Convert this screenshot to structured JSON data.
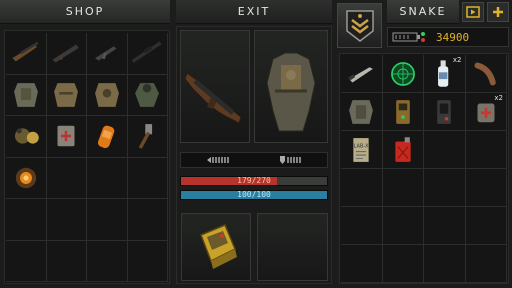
{
  "header": {
    "shop_label": "SHOP",
    "exit_label": "EXIT",
    "player_label": "SNAKE",
    "money": "34900",
    "rank_icon": "rank-chevron-icon",
    "add_icon": "plus-icon",
    "video_icon": "video-reward-icon"
  },
  "shop": {
    "items": [
      {
        "name": "rifle",
        "multiplier": ""
      },
      {
        "name": "assault-rifle",
        "multiplier": ""
      },
      {
        "name": "pistol",
        "multiplier": ""
      },
      {
        "name": "sniper-rifle",
        "multiplier": ""
      },
      {
        "name": "armor-vest",
        "multiplier": ""
      },
      {
        "name": "tactical-vest",
        "multiplier": ""
      },
      {
        "name": "exoskeleton",
        "multiplier": ""
      },
      {
        "name": "hazmat-suit",
        "multiplier": ""
      },
      {
        "name": "gas-mask",
        "multiplier": ""
      },
      {
        "name": "medkit-pouch",
        "multiplier": ""
      },
      {
        "name": "energy-drink",
        "multiplier": ""
      },
      {
        "name": "hammer",
        "multiplier": ""
      },
      {
        "name": "artifact",
        "multiplier": ""
      }
    ]
  },
  "equipment": {
    "weapon_slot": "equipped-rifle",
    "armor_slot": "equipped-exoskeleton",
    "indicator_left": "ammo-gauge-icon",
    "indicator_right": "armor-gauge-icon",
    "health_text": "179/270",
    "health_fraction": 0.66,
    "health_color": "#b8332b",
    "stamina_text": "100/100",
    "stamina_fraction": 1.0,
    "stamina_color": "#2b7f9e",
    "quick_slot_1": "quick-pda",
    "quick_slot_2": ""
  },
  "inventory": {
    "items": [
      {
        "name": "knife",
        "multiplier": ""
      },
      {
        "name": "radar-anomaly",
        "multiplier": ""
      },
      {
        "name": "vodka-bottle",
        "multiplier": "x2"
      },
      {
        "name": "sausage",
        "multiplier": ""
      },
      {
        "name": "armor-suit",
        "multiplier": ""
      },
      {
        "name": "detector",
        "multiplier": ""
      },
      {
        "name": "pda",
        "multiplier": ""
      },
      {
        "name": "first-aid-bag",
        "multiplier": "x2"
      },
      {
        "name": "lab-x-document",
        "multiplier": ""
      },
      {
        "name": "fuel-canister",
        "multiplier": ""
      }
    ]
  }
}
